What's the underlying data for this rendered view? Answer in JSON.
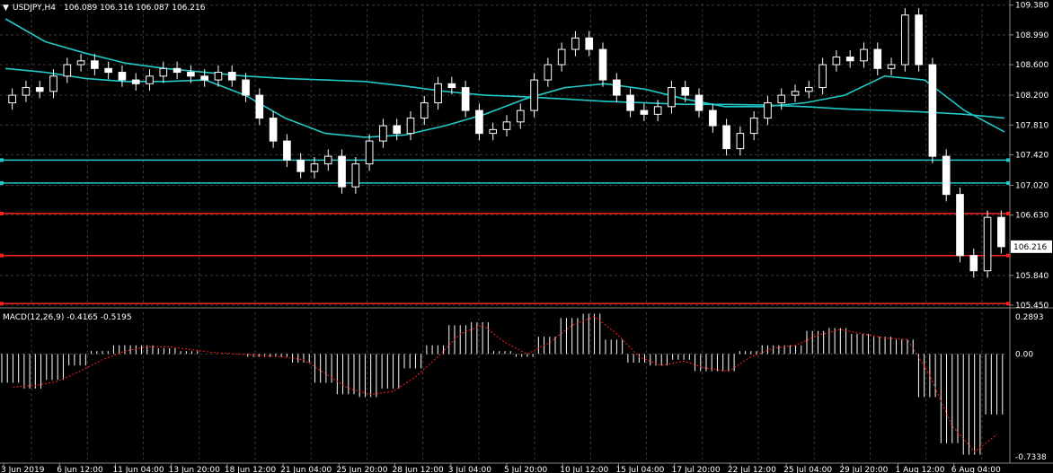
{
  "header": {
    "symbol_label": "USDJPY,H4",
    "ohlc_label": "106.089 106.316 106.087 106.216",
    "dropdown_icon": "triangle-down-icon"
  },
  "macd_label": "MACD(12,26,9) -0.4165 -0.5195",
  "current_price_label": "106.216",
  "colors": {
    "background": "#000000",
    "grid": "#3a3a3a",
    "candles": "#ffffff",
    "moving_averages": "#20c8c8",
    "support_lines": "#20c8c8",
    "resistance_lines": "#ff2020",
    "macd_histogram": "#ffffff",
    "macd_signal": "#ff2020"
  },
  "chart_data": [
    {
      "type": "candlestick",
      "title": "USDJPY,H4",
      "ylim": [
        105.45,
        109.4
      ],
      "y_ticks": [
        "109.380",
        "108.990",
        "108.600",
        "108.200",
        "107.810",
        "107.420",
        "107.020",
        "106.630",
        "105.840",
        "105.450"
      ],
      "x_labels": [
        "3 Jun 2019",
        "6 Jun 12:00",
        "11 Jun 04:00",
        "13 Jun 20:00",
        "18 Jun 12:00",
        "21 Jun 04:00",
        "25 Jun 20:00",
        "28 Jun 12:00",
        "3 Jul 04:00",
        "5 Jul 20:00",
        "10 Jul 12:00",
        "15 Jul 04:00",
        "17 Jul 20:00",
        "22 Jul 12:00",
        "25 Jul 04:00",
        "29 Jul 20:00",
        "1 Aug 12:00",
        "6 Aug 04:00"
      ],
      "last_price": 106.216,
      "close_series": [
        108.2,
        108.3,
        108.25,
        108.45,
        108.6,
        108.65,
        108.55,
        108.5,
        108.4,
        108.35,
        108.45,
        108.55,
        108.5,
        108.45,
        108.4,
        108.5,
        108.4,
        108.2,
        107.9,
        107.6,
        107.35,
        107.2,
        107.3,
        107.4,
        107.0,
        107.3,
        107.6,
        107.8,
        107.7,
        107.9,
        108.1,
        108.35,
        108.3,
        108.0,
        107.7,
        107.75,
        107.85,
        108.0,
        108.4,
        108.6,
        108.8,
        108.95,
        108.8,
        108.4,
        108.2,
        108.0,
        107.95,
        108.05,
        108.3,
        108.2,
        108.0,
        107.8,
        107.5,
        107.7,
        107.9,
        108.1,
        108.2,
        108.25,
        108.3,
        108.6,
        108.7,
        108.65,
        108.8,
        108.55,
        108.6,
        109.25,
        108.6,
        107.4,
        106.9,
        106.1,
        105.9,
        106.6,
        106.216
      ],
      "series": [
        {
          "name": "",
          "kind": "moving-average",
          "values": [
            109.2,
            108.9,
            108.75,
            108.62,
            108.55,
            108.5,
            108.45,
            108.42,
            108.4,
            108.38,
            108.32,
            108.25,
            108.2,
            108.18,
            108.15,
            108.12,
            108.1,
            108.08,
            108.08,
            108.07,
            108.05,
            108.02,
            108.0,
            107.98,
            107.95,
            107.9
          ]
        },
        {
          "name": "",
          "kind": "moving-average",
          "values": [
            108.55,
            108.5,
            108.42,
            108.38,
            108.38,
            108.4,
            108.2,
            107.9,
            107.7,
            107.65,
            107.68,
            107.8,
            107.95,
            108.15,
            108.3,
            108.35,
            108.28,
            108.15,
            108.05,
            108.05,
            108.1,
            108.2,
            108.45,
            108.4,
            108.0,
            107.72
          ]
        }
      ],
      "horizontal_lines": [
        {
          "kind": "support",
          "price": 107.35
        },
        {
          "kind": "support",
          "price": 107.05
        },
        {
          "kind": "resistance",
          "price": 106.65
        },
        {
          "kind": "resistance",
          "price": 106.1
        },
        {
          "kind": "resistance",
          "price": 105.47
        }
      ]
    },
    {
      "type": "bar",
      "title": "MACD(12,26,9) -0.4165 -0.5195",
      "ylim": [
        -0.7338,
        0.2893
      ],
      "y_ticks": [
        "0.2893",
        "0.00",
        "-0.7338"
      ],
      "values": [
        -0.2,
        -0.24,
        -0.18,
        -0.08,
        0.02,
        0.06,
        0.06,
        0.04,
        0.02,
        0.0,
        0.0,
        -0.02,
        -0.02,
        -0.06,
        -0.2,
        -0.28,
        -0.3,
        -0.24,
        -0.1,
        0.06,
        0.2,
        0.22,
        0.02,
        -0.02,
        0.12,
        0.25,
        0.28,
        0.1,
        -0.06,
        -0.08,
        -0.04,
        -0.12,
        -0.12,
        0.02,
        0.06,
        0.06,
        0.16,
        0.18,
        0.14,
        0.12,
        0.1,
        -0.3,
        -0.62,
        -0.7,
        -0.42
      ],
      "signal": [
        -0.23,
        -0.22,
        -0.19,
        -0.12,
        -0.04,
        0.02,
        0.05,
        0.05,
        0.03,
        0.01,
        0.0,
        -0.01,
        -0.02,
        -0.04,
        -0.14,
        -0.24,
        -0.28,
        -0.26,
        -0.16,
        -0.02,
        0.14,
        0.2,
        0.08,
        0.0,
        0.08,
        0.2,
        0.26,
        0.14,
        -0.02,
        -0.08,
        -0.05,
        -0.1,
        -0.12,
        -0.02,
        0.04,
        0.06,
        0.13,
        0.17,
        0.14,
        0.11,
        0.1,
        -0.15,
        -0.5,
        -0.68,
        -0.56
      ]
    }
  ]
}
